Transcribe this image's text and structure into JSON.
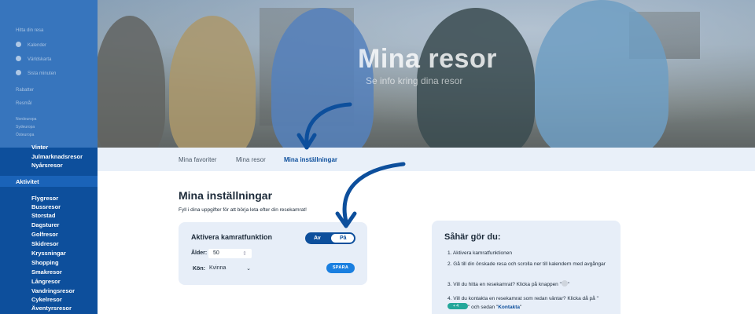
{
  "hero": {
    "title": "Mina resor",
    "subtitle": "Se info kring dina resor"
  },
  "sidebar": {
    "faded_items": [
      "Hitta din resa",
      "Kalender",
      "Världskarta",
      "Sista minuten",
      "Rabatter",
      "Resmål",
      "Nordeuropa",
      "Sydeuropa",
      "Östeuropa"
    ],
    "items": [
      "Vinter",
      "Julmarknadsresor",
      "Nyårsresor"
    ],
    "section": "Aktivitet",
    "activities": [
      "Flygresor",
      "Bussresor",
      "Storstad",
      "Dagsturer",
      "Golfresor",
      "Skidresor",
      "Kryssningar",
      "Shopping",
      "Smakresor",
      "Långresor",
      "Vandringsresor",
      "Cykelresor",
      "Äventyrsresor"
    ]
  },
  "tabs": [
    {
      "label": "Mina favoriter",
      "active": false
    },
    {
      "label": "Mina resor",
      "active": false
    },
    {
      "label": "Mina inställningar",
      "active": true
    }
  ],
  "settings": {
    "title": "Mina inställningar",
    "lead": "Fyll i dina uppgifter för att börja leta efter din resekamrat!",
    "card_title": "Aktivera kamratfunktion",
    "toggle": {
      "off_label": "Av",
      "on_label": "På",
      "state": "on"
    },
    "age_label": "Ålder:",
    "age_value": "50",
    "gender_label": "Kön:",
    "gender_value": "Kvinna",
    "save_label": "SPARA"
  },
  "help": {
    "title": "Såhär gör du:",
    "steps": [
      "1. Aktivera kamratfunktionen",
      "2. Gå till din önskade resa och scrolla ner till kalendern med avgångar",
      "3. Vill du hitta en resekamrat? Klicka på knappen \"",
      "4. Vill du kontakta en resekamrat som redan väntar? Klicka då på \""
    ],
    "step3_end": "\"",
    "step4_mid": "\" och sedan \"",
    "step4_link": "Kontakta",
    "step4_end": "\"",
    "chip_text": "+ 4"
  },
  "colors": {
    "brand": "#0d4f9c",
    "accent": "#1a7fe0",
    "teal": "#23a79b",
    "panel": "#e7eef8"
  }
}
